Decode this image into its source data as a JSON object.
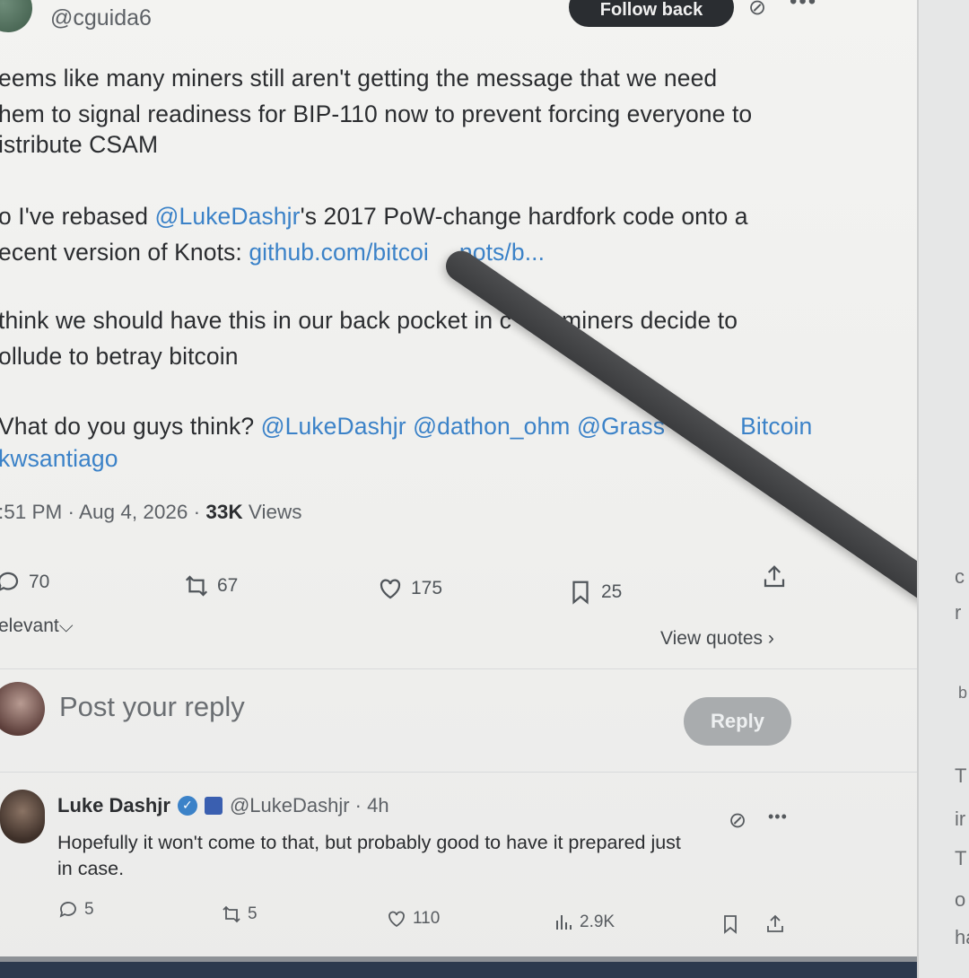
{
  "header": {
    "handle": "@cguida6",
    "follow_label": "Follow back",
    "more_icon": "more-horizontal-icon",
    "grok_icon": "grok-icon"
  },
  "tweet": {
    "lines": [
      "eems like many miners still aren't getting the message that we need",
      "hem to signal readiness for BIP-110 now to prevent forcing everyone to",
      "istribute CSAM"
    ],
    "p2_a": "o I've rebased ",
    "p2_mention": "@LukeDashjr",
    "p2_b": "'s 2017 PoW-change hardfork code onto a",
    "p2_c": "ecent version of Knots: ",
    "p2_link": "github.com/bitcoi",
    "p2_link2": "nots/b...",
    "p3_a": "think we should have this in our back pocket in c",
    "p3_b": "miners decide to",
    "p3_c": "ollude to betray bitcoin",
    "p4_a": "Vhat do you guys think? ",
    "p4_m1": "@LukeDashjr",
    "p4_m2": "@dathon_ohm",
    "p4_m3": "@Grass",
    "p4_m4": "Bitcoin",
    "p4_m5": "kwsantiago",
    "time": ":51 PM · Aug 4, 2026 · ",
    "views_count": "33K",
    "views_label": " Views"
  },
  "actions": {
    "replies": "70",
    "reposts": "67",
    "likes": "175",
    "bookmarks": "25"
  },
  "sort": {
    "label": "elevant"
  },
  "view_quotes": "View quotes",
  "reply_box": {
    "placeholder": "Post your reply",
    "button": "Reply"
  },
  "reply": {
    "name": "Luke Dashjr",
    "handle": "@LukeDashjr · 4h",
    "line1": "Hopefully it won't come to that, but probably good to have it prepared just",
    "line2": "in case.",
    "replies": "5",
    "reposts": "5",
    "likes": "110",
    "views": "2.9K"
  },
  "side_panel": {
    "chars": [
      "c",
      "r",
      "b",
      "T",
      "ir",
      "T",
      "o",
      "ha"
    ]
  },
  "colors": {
    "link": "#3b82c8",
    "follow_bg": "#2a2d31",
    "reply_btn_bg": "#a9acae"
  }
}
